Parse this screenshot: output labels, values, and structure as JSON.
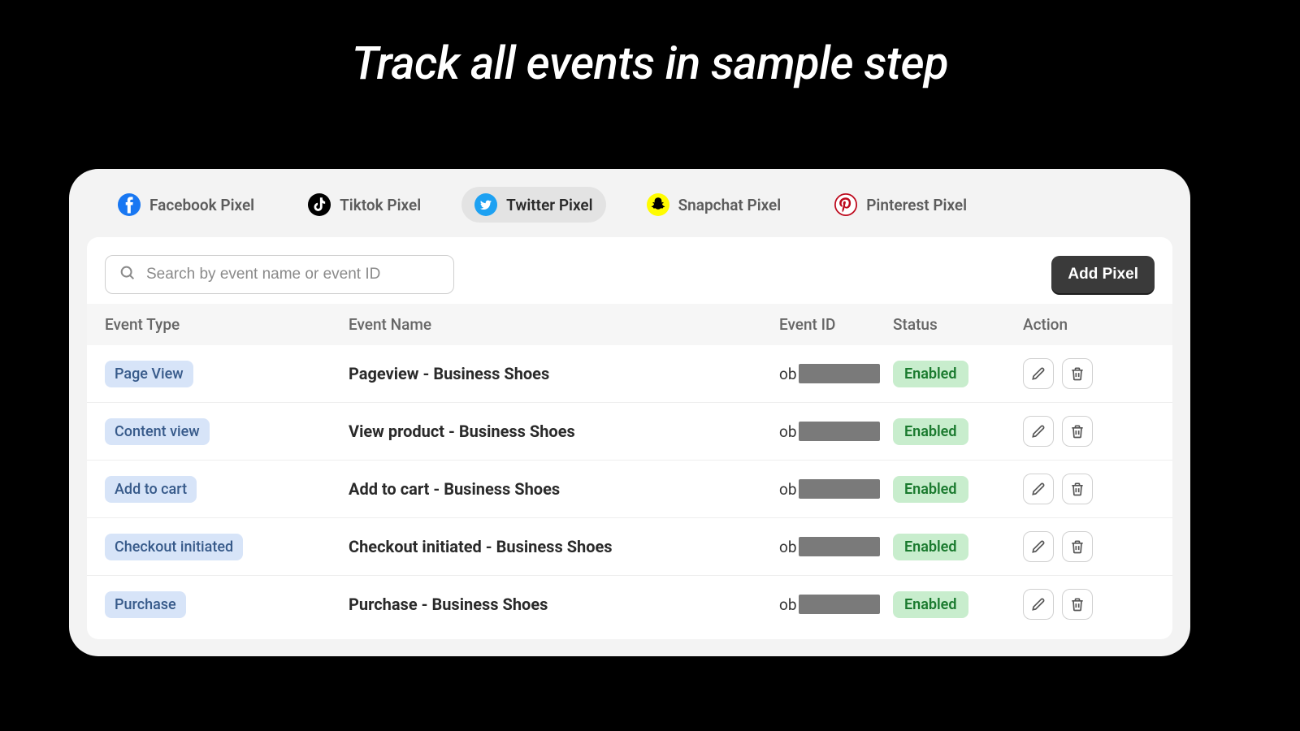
{
  "headline": "Track all events in sample step",
  "tabs": [
    {
      "label": "Facebook Pixel",
      "icon": "facebook-icon",
      "active": false
    },
    {
      "label": "Tiktok Pixel",
      "icon": "tiktok-icon",
      "active": false
    },
    {
      "label": "Twitter Pixel",
      "icon": "twitter-icon",
      "active": true
    },
    {
      "label": "Snapchat Pixel",
      "icon": "snapchat-icon",
      "active": false
    },
    {
      "label": "Pinterest Pixel",
      "icon": "pinterest-icon",
      "active": false
    }
  ],
  "search": {
    "placeholder": "Search by event name or event ID"
  },
  "add_button": "Add Pixel",
  "columns": {
    "type": "Event Type",
    "name": "Event Name",
    "id": "Event ID",
    "status": "Status",
    "action": "Action"
  },
  "status_enabled": "Enabled",
  "rows": [
    {
      "type": "Page View",
      "name": "Pageview - Business Shoes",
      "id_prefix": "ob",
      "status": "Enabled"
    },
    {
      "type": "Content view",
      "name": "View product - Business Shoes",
      "id_prefix": "ob",
      "status": "Enabled"
    },
    {
      "type": "Add to cart",
      "name": "Add to cart - Business Shoes",
      "id_prefix": "ob",
      "status": "Enabled"
    },
    {
      "type": "Checkout initiated",
      "name": "Checkout initiated - Business Shoes",
      "id_prefix": "ob",
      "status": "Enabled"
    },
    {
      "type": "Purchase",
      "name": "Purchase - Business Shoes",
      "id_prefix": "ob",
      "status": "Enabled"
    }
  ],
  "colors": {
    "type_badge_bg": "#d7e4f8",
    "status_badge_bg": "#c8edcd"
  }
}
